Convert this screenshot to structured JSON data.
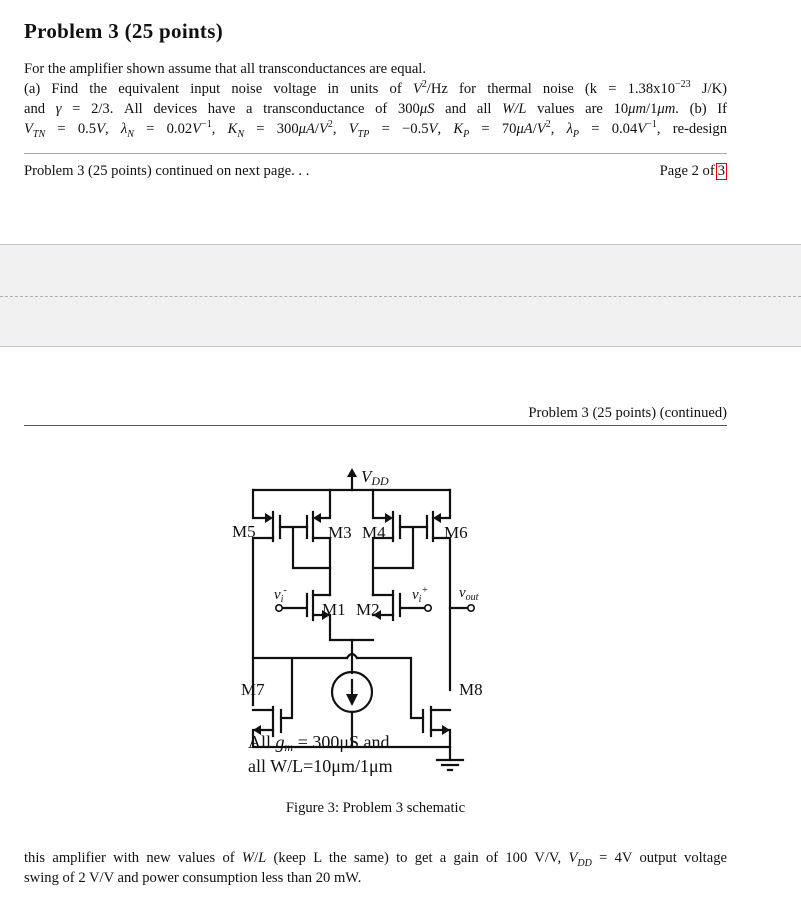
{
  "problem": {
    "title": "Problem 3 (25 points)",
    "lines": [
      "For the amplifier shown assume that all transconductances are equal.",
      "(a) Find the equivalent input noise voltage in units of V²/Hz for thermal noise (k = 1.38x10⁻²³ J/K)",
      "and γ = 2/3. All devices have a transconductance of 300μS and all W/L values are 10μm/1μm. (b) If",
      "V_TN = 0.5V, λ_N = 0.02V⁻¹, K_N = 300μA/V², V_TP = −0.5V, K_P = 70μA/V², λ_P = 0.04V⁻¹, re-design"
    ]
  },
  "page_footer": {
    "left": "Problem 3 (25 points)  continued on next page. . .",
    "page_label": "Page 2 of",
    "page_total": "3"
  },
  "next_page_header": "Problem 3 (25 points)  (continued)",
  "schematic": {
    "supply_label": "VDD",
    "transistors": [
      "M1",
      "M2",
      "M3",
      "M4",
      "M5",
      "M6",
      "M7",
      "M8"
    ],
    "inputs": {
      "minus": "vi-",
      "plus": "vi+"
    },
    "output": "vout",
    "note_line1": "All gm = 300μS and",
    "note_line2": "all W/L=10μm/1μm"
  },
  "figure_caption": "Figure 3:  Problem 3 schematic",
  "continuation": {
    "line1": "this amplifier with new values of W/L (keep L the same) to get a gain of 100 V/V, V_DD = 4V output voltage",
    "line2": "swing of 2 V/V and power consumption less than 20 mW."
  }
}
